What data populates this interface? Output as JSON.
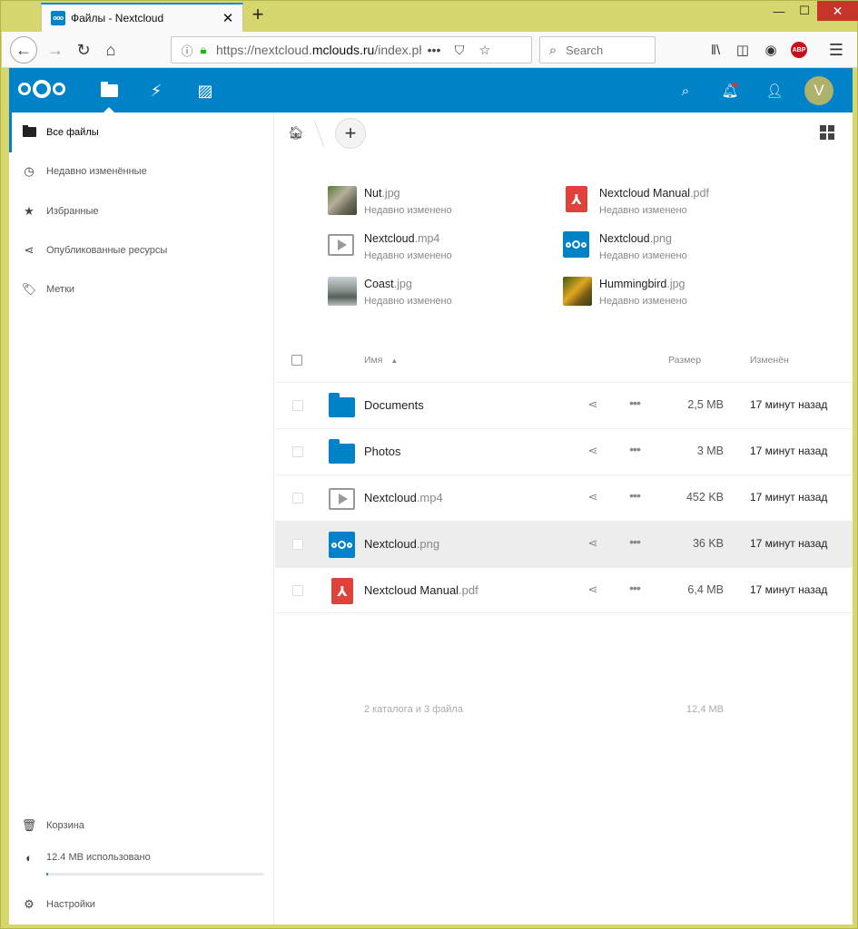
{
  "browser": {
    "tab_title": "Файлы - Nextcloud",
    "tab_favicon": "ooo",
    "new_tab": "+",
    "url_prefix": "https://nextcloud.",
    "url_domain": "mclouds.ru",
    "url_suffix": "/index.php",
    "search_placeholder": "Search",
    "adblock_label": "ABP",
    "more_glyph": "•••"
  },
  "header": {
    "avatar_letter": "V"
  },
  "sidebar": {
    "items": [
      {
        "label": "Все файлы",
        "icon": "folder-icon"
      },
      {
        "label": "Недавно изменённые",
        "icon": "clock-icon"
      },
      {
        "label": "Избранные",
        "icon": "star-icon"
      },
      {
        "label": "Опубликованные ресурсы",
        "icon": "share-icon"
      },
      {
        "label": "Метки",
        "icon": "tag-icon"
      }
    ],
    "trash": "Корзина",
    "quota": "12.4 MB использовано",
    "quota_fraction": 0.01,
    "settings": "Настройки"
  },
  "recent": [
    {
      "name": "Nut",
      "ext": ".jpg",
      "sub": "Недавно изменено"
    },
    {
      "name": "Nextcloud Manual",
      "ext": ".pdf",
      "sub": "Недавно изменено"
    },
    {
      "name": "Nextcloud",
      "ext": ".mp4",
      "sub": "Недавно изменено"
    },
    {
      "name": "Nextcloud",
      "ext": ".png",
      "sub": "Недавно изменено"
    },
    {
      "name": "Coast",
      "ext": ".jpg",
      "sub": "Недавно изменено"
    },
    {
      "name": "Hummingbird",
      "ext": ".jpg",
      "sub": "Недавно изменено"
    }
  ],
  "table": {
    "col_name": "Имя",
    "col_size": "Размер",
    "col_modified": "Изменён",
    "rows": [
      {
        "name": "Documents",
        "ext": "",
        "size": "2,5 MB",
        "modified": "17 минут назад"
      },
      {
        "name": "Photos",
        "ext": "",
        "size": "3 MB",
        "modified": "17 минут назад"
      },
      {
        "name": "Nextcloud",
        "ext": ".mp4",
        "size": "452 KB",
        "modified": "17 минут назад"
      },
      {
        "name": "Nextcloud",
        "ext": ".png",
        "size": "36 KB",
        "modified": "17 минут назад"
      },
      {
        "name": "Nextcloud Manual",
        "ext": ".pdf",
        "size": "6,4 MB",
        "modified": "17 минут назад"
      }
    ],
    "summary_count": "2 каталога и 3 файла",
    "summary_size": "12,4 MB"
  },
  "colors": {
    "brand": "#0082c9",
    "pdf": "#e0413a",
    "window_frame": "#d6d66f"
  }
}
